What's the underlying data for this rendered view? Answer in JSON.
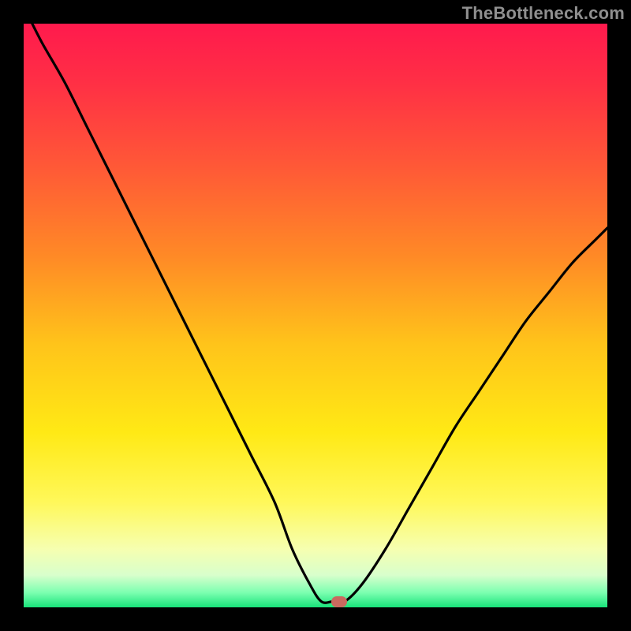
{
  "watermark": "TheBottleneck.com",
  "colors": {
    "dot": "#c96a5f",
    "curve_stroke": "#000000",
    "frame_bg": "#000000"
  },
  "gradient_stops": [
    {
      "offset": 0.0,
      "color": "#ff1a4d"
    },
    {
      "offset": 0.1,
      "color": "#ff2f45"
    },
    {
      "offset": 0.25,
      "color": "#ff5a36"
    },
    {
      "offset": 0.4,
      "color": "#ff8a26"
    },
    {
      "offset": 0.55,
      "color": "#ffc41a"
    },
    {
      "offset": 0.7,
      "color": "#ffe915"
    },
    {
      "offset": 0.82,
      "color": "#fff85a"
    },
    {
      "offset": 0.9,
      "color": "#f6ffb0"
    },
    {
      "offset": 0.945,
      "color": "#d8ffcc"
    },
    {
      "offset": 0.975,
      "color": "#7bffb0"
    },
    {
      "offset": 1.0,
      "color": "#18e37a"
    }
  ],
  "chart_data": {
    "type": "line",
    "title": "",
    "xlabel": "",
    "ylabel": "",
    "xlim": [
      0,
      1
    ],
    "ylim": [
      0,
      1
    ],
    "series": [
      {
        "name": "bottleneck-curve",
        "x": [
          0.0,
          0.03,
          0.07,
          0.11,
          0.15,
          0.19,
          0.23,
          0.27,
          0.31,
          0.35,
          0.39,
          0.43,
          0.46,
          0.49,
          0.51,
          0.53,
          0.55,
          0.58,
          0.62,
          0.66,
          0.7,
          0.74,
          0.78,
          0.82,
          0.86,
          0.9,
          0.94,
          0.98,
          1.0
        ],
        "y": [
          1.03,
          0.97,
          0.9,
          0.82,
          0.74,
          0.66,
          0.58,
          0.5,
          0.42,
          0.34,
          0.26,
          0.18,
          0.1,
          0.04,
          0.01,
          0.01,
          0.01,
          0.04,
          0.1,
          0.17,
          0.24,
          0.31,
          0.37,
          0.43,
          0.49,
          0.54,
          0.59,
          0.63,
          0.65
        ]
      }
    ],
    "marker": {
      "x": 0.54,
      "y": 0.01
    },
    "grid": false,
    "legend": false
  }
}
